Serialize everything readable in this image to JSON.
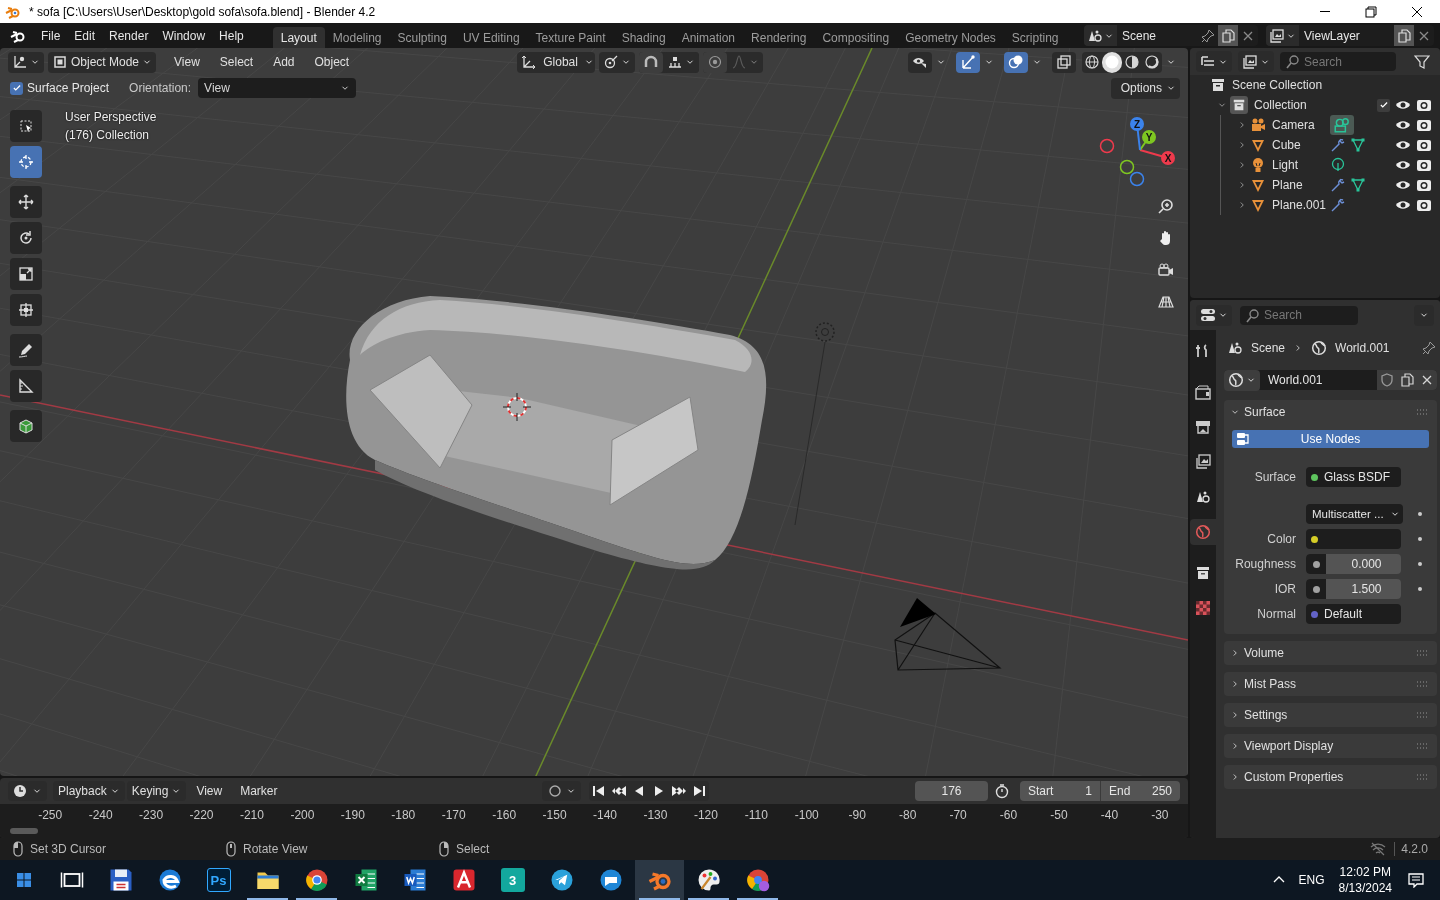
{
  "window": {
    "title": "* sofa [C:\\Users\\User\\Desktop\\gold sofa\\sofa.blend] - Blender 4.2"
  },
  "menu": [
    "File",
    "Edit",
    "Render",
    "Window",
    "Help"
  ],
  "workspaces": [
    {
      "label": "Layout",
      "selected": true
    },
    {
      "label": "Modeling",
      "selected": false
    },
    {
      "label": "Sculpting",
      "selected": false
    },
    {
      "label": "UV Editing",
      "selected": false
    },
    {
      "label": "Texture Paint",
      "selected": false
    },
    {
      "label": "Shading",
      "selected": false
    },
    {
      "label": "Animation",
      "selected": false
    },
    {
      "label": "Rendering",
      "selected": false
    },
    {
      "label": "Compositing",
      "selected": false
    },
    {
      "label": "Geometry Nodes",
      "selected": false
    },
    {
      "label": "Scripting",
      "selected": false
    }
  ],
  "scene": "Scene",
  "view_layer": "ViewLayer",
  "viewport": {
    "mode": "Object Mode",
    "menus": [
      "View",
      "Select",
      "Add",
      "Object"
    ],
    "transform_orientation": "Global",
    "toggles": [
      {
        "kind": "visibility",
        "on": false
      },
      {
        "kind": "gizmos",
        "on": true
      },
      {
        "kind": "overlays",
        "on": true
      },
      {
        "kind": "xray",
        "on": false
      }
    ],
    "shading": [
      {
        "kind": "wireframe",
        "selected": false
      },
      {
        "kind": "solid",
        "selected": true
      },
      {
        "kind": "material",
        "selected": false
      },
      {
        "kind": "rendered",
        "selected": false
      }
    ],
    "surface_project": {
      "label": "Surface Project",
      "checked": true
    },
    "orientation_label": "Orientation:",
    "orientation": "View",
    "options": "Options",
    "info": [
      "User Perspective",
      "(176) Collection"
    ],
    "tools": [
      {
        "kind": "select",
        "selected": false
      },
      {
        "kind": "cursor",
        "selected": true
      },
      {
        "kind": "move",
        "selected": false
      },
      {
        "kind": "rotate",
        "selected": false
      },
      {
        "kind": "scale",
        "selected": false
      },
      {
        "kind": "transform",
        "selected": false
      },
      {
        "kind": "annotate",
        "selected": false
      },
      {
        "kind": "measure",
        "selected": false
      },
      {
        "kind": "cube",
        "selected": false
      }
    ],
    "gizmo_axes": [
      {
        "label": "X",
        "color": "#ee3a4c"
      },
      {
        "label": "Y",
        "color": "#7ec621"
      },
      {
        "label": "Z",
        "color": "#3b83ec"
      }
    ]
  },
  "outliner": {
    "search_placeholder": "Search",
    "root": "Scene Collection",
    "items": [
      {
        "label": "Collection",
        "kind": "collection",
        "expanded": true,
        "checked": true,
        "visible": true,
        "renderable": true,
        "children": [
          {
            "label": "Camera",
            "kind": "camera",
            "expanded": false,
            "visible": true,
            "renderable": true,
            "data_icons": [
              {
                "kind": "camera"
              }
            ]
          },
          {
            "label": "Cube",
            "kind": "mesh",
            "expanded": false,
            "visible": true,
            "renderable": true,
            "data_icons": [
              {
                "kind": "modifier"
              },
              {
                "kind": "mesh"
              }
            ]
          },
          {
            "label": "Light",
            "kind": "light",
            "expanded": false,
            "visible": true,
            "renderable": true,
            "data_icons": [
              {
                "kind": "light"
              }
            ]
          },
          {
            "label": "Plane",
            "kind": "mesh",
            "expanded": false,
            "visible": true,
            "renderable": true,
            "data_icons": [
              {
                "kind": "modifier"
              },
              {
                "kind": "mesh"
              }
            ]
          },
          {
            "label": "Plane.001",
            "kind": "mesh",
            "expanded": false,
            "visible": true,
            "renderable": true,
            "data_icons": [
              {
                "kind": "modifier"
              }
            ]
          }
        ]
      }
    ]
  },
  "properties": {
    "search_placeholder": "Search",
    "tabs": [
      {
        "kind": "tool",
        "selected": false
      },
      {
        "kind": "render",
        "selected": false
      },
      {
        "kind": "output",
        "selected": false
      },
      {
        "kind": "viewlayer",
        "selected": false
      },
      {
        "kind": "scene",
        "selected": false
      },
      {
        "kind": "world",
        "selected": true
      },
      {
        "kind": "collection",
        "selected": false
      },
      {
        "kind": "texture",
        "selected": false
      }
    ],
    "breadcrumb": [
      "Scene",
      "World.001"
    ],
    "datablock": "World.001",
    "panels": [
      {
        "label": "Surface",
        "expanded": true
      },
      {
        "label": "Volume",
        "expanded": false
      },
      {
        "label": "Mist Pass",
        "expanded": false
      },
      {
        "label": "Settings",
        "expanded": false
      },
      {
        "label": "Viewport Display",
        "expanded": false
      },
      {
        "label": "Custom Properties",
        "expanded": false
      }
    ],
    "use_nodes": "Use Nodes",
    "fields": [
      {
        "kind": "link",
        "label": "Surface",
        "value": "Glass BSDF",
        "color": "#5ec45e"
      },
      {
        "kind": "dropdown",
        "value": "Multiscatter ..."
      },
      {
        "kind": "color",
        "label": "Color",
        "color": "#d5cd27"
      },
      {
        "kind": "number",
        "label": "Roughness",
        "value": "0.000",
        "color": "#a1a1a1"
      },
      {
        "kind": "number",
        "label": "IOR",
        "value": "1.500",
        "color": "#a1a1a1"
      },
      {
        "kind": "link",
        "label": "Normal",
        "value": "Default",
        "color": "#6363c7"
      }
    ]
  },
  "timeline": {
    "menus": [
      {
        "label": "Playback",
        "dropdown": true
      },
      {
        "label": "Keying",
        "dropdown": true
      },
      {
        "label": "View",
        "dropdown": false
      },
      {
        "label": "Marker",
        "dropdown": false
      }
    ],
    "auto_keying": false,
    "current_frame": "176",
    "start_label": "Start",
    "start": "1",
    "end_label": "End",
    "end": "250",
    "ticks": [
      "-250",
      "-240",
      "-230",
      "-220",
      "-210",
      "-200",
      "-190",
      "-180",
      "-170",
      "-160",
      "-150",
      "-140",
      "-130",
      "-120",
      "-110",
      "-100",
      "-90",
      "-80",
      "-70",
      "-60",
      "-50",
      "-40",
      "-30"
    ]
  },
  "status_bar": {
    "hints": [
      {
        "kind": "left",
        "label": "Set 3D Cursor"
      },
      {
        "kind": "middle",
        "label": "Rotate View"
      },
      {
        "kind": "right",
        "label": "Select"
      }
    ],
    "version": "4.2.0"
  },
  "taskbar": {
    "apps": [
      {
        "kind": "taskview",
        "running": false,
        "selected": false
      },
      {
        "kind": "save",
        "running": false,
        "selected": false
      },
      {
        "kind": "edge",
        "running": false,
        "selected": false
      },
      {
        "kind": "photoshop",
        "label": "Ps",
        "running": false,
        "selected": false
      },
      {
        "kind": "explorer",
        "running": true,
        "selected": false
      },
      {
        "kind": "chrome",
        "running": true,
        "selected": false
      },
      {
        "kind": "excel",
        "running": false,
        "selected": false
      },
      {
        "kind": "word",
        "running": false,
        "selected": false
      },
      {
        "kind": "acrobat",
        "running": false,
        "selected": false
      },
      {
        "kind": "max",
        "label": "3",
        "running": false,
        "selected": false
      },
      {
        "kind": "telegram",
        "running": false,
        "selected": false
      },
      {
        "kind": "chat",
        "running": false,
        "selected": false
      },
      {
        "kind": "blender",
        "running": true,
        "selected": true
      },
      {
        "kind": "paint",
        "running": true,
        "selected": false
      },
      {
        "kind": "chromeprofile",
        "running": true,
        "selected": false
      }
    ],
    "language": "ENG",
    "time": "12:02 PM",
    "date": "8/13/2024"
  }
}
